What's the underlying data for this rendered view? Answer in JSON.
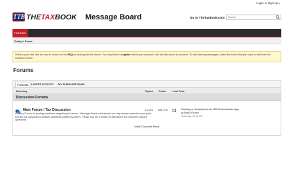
{
  "topbar": {
    "login_label": "Login or Sign Up",
    "caret": "▾"
  },
  "header": {
    "logo_mark": "TTB",
    "logo_the": "THE",
    "logo_tax": "TAX",
    "logo_book": "BOOK",
    "site_title": "Message Board",
    "goto_link": "Go to TheTaxBook.com",
    "search_placeholder": "Search"
  },
  "nav": {
    "forums_tab": "FORUMS",
    "todays_posts": "Today's Posts"
  },
  "notice": {
    "text_1": "If this is your first visit, be sure to check out the ",
    "faq": "FAQ",
    "text_2": " by clicking the link above. You may have to ",
    "register": "register",
    "text_3": " before you can post: click the link above to proceed. To start viewing messages, select the forum that you want to visit from the selection below."
  },
  "page_title": "Forums",
  "tabs": [
    {
      "label": "FORUMS"
    },
    {
      "label": "LATEST ACTIVITY"
    },
    {
      "label": "MY SUBSCRIPTIONS"
    }
  ],
  "columns": {
    "directory": "Directory",
    "topics": "Topics",
    "posts": "Posts",
    "last_post": "Last Post"
  },
  "category": "Discussion Forums",
  "forum": {
    "title": "Main Forum / Tax Discussion",
    "description": "Primary Forum for posting questions regarding tax issues. Message Board participants can help answer questions you post, but are not supposed to answer questions posted by others. Please use the Contact Us link above for customer support questions.",
    "topics": "31,278",
    "posts": "204,975",
    "last_post_title": "Desktop or Smartphone for IRS Authenticator App",
    "last_post_by": "by Rapid Robert",
    "last_post_date": "Yesterday, 03:15 PM"
  },
  "mark_read": "Mark Channels Read",
  "colors": {
    "brand_red": "#c41e2a",
    "brand_navy": "#1e2a6e",
    "nav_dark": "#2c2c2c",
    "notice_bg": "#fff7cf"
  }
}
